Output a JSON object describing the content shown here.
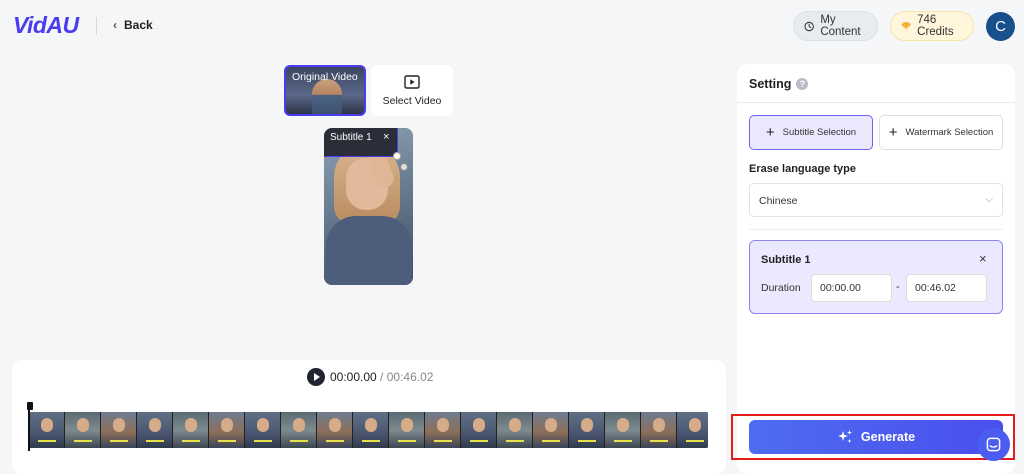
{
  "header": {
    "logo": "VidAU",
    "back_label": "Back",
    "my_content_label": "My Content",
    "credits_label": "746 Credits",
    "avatar_letter": "C"
  },
  "preview": {
    "original_tab_label": "Original Video",
    "select_tab_label": "Select Video",
    "subtitle_box_label": "Subtitle 1",
    "subtitle_close": "×"
  },
  "player": {
    "current_time": "00:00.00",
    "separator": " / ",
    "total_time": "00:46.02"
  },
  "settings": {
    "title": "Setting",
    "help": "?",
    "subtitle_selection_label": "Subtitle Selection",
    "watermark_selection_label": "Watermark Selection",
    "erase_language_label": "Erase language type",
    "erase_language_value": "Chinese",
    "subtitle_card": {
      "title": "Subtitle 1",
      "close": "×",
      "duration_label": "Duration",
      "start": "00:00.00",
      "dash": "-",
      "end": "00:46.02"
    },
    "generate_label": "Generate"
  },
  "colors": {
    "accent": "#4a3cf0",
    "generate": "#4e6cf2",
    "highlight_outline": "#e11d1d",
    "credits_bg": "#fff6dc"
  }
}
